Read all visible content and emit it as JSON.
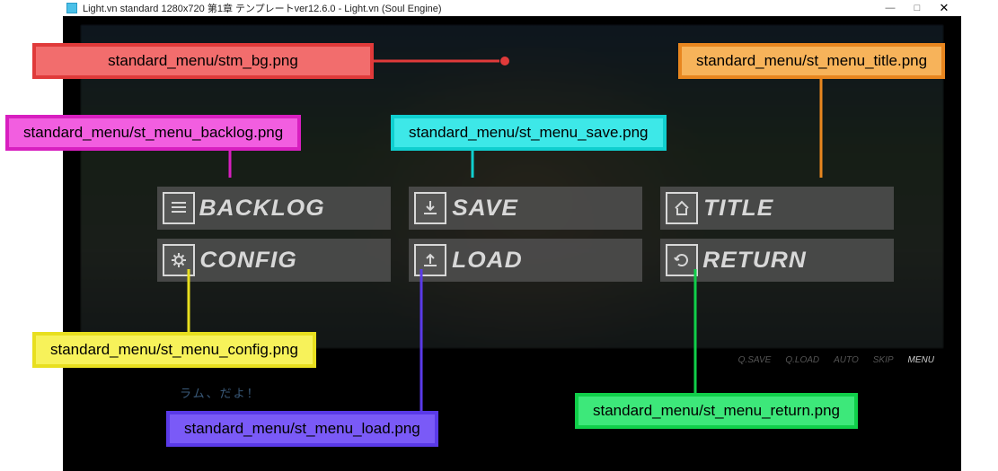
{
  "window": {
    "title": "Light.vn standard 1280x720 第1章 テンプレートver12.6.0 - Light.vn (Soul Engine)",
    "min": "—",
    "max": "□",
    "close": "✕"
  },
  "menu": {
    "backlog": "BACKLOG",
    "save": "SAVE",
    "title": "TITLE",
    "config": "CONFIG",
    "load": "LOAD",
    "return": "RETURN"
  },
  "bottombar": {
    "i1": "Q.SAVE",
    "i2": "Q.LOAD",
    "i3": "AUTO",
    "i4": "SKIP",
    "i5": "MENU"
  },
  "dialogue": "ラム、だよ！",
  "annotations": {
    "bg": "standard_menu/stm_bg.png",
    "title": "standard_menu/st_menu_title.png",
    "backlog": "standard_menu/st_menu_backlog.png",
    "save": "standard_menu/st_menu_save.png",
    "config": "standard_menu/st_menu_config.png",
    "load": "standard_menu/st_menu_load.png",
    "return": "standard_menu/st_menu_return.png"
  }
}
